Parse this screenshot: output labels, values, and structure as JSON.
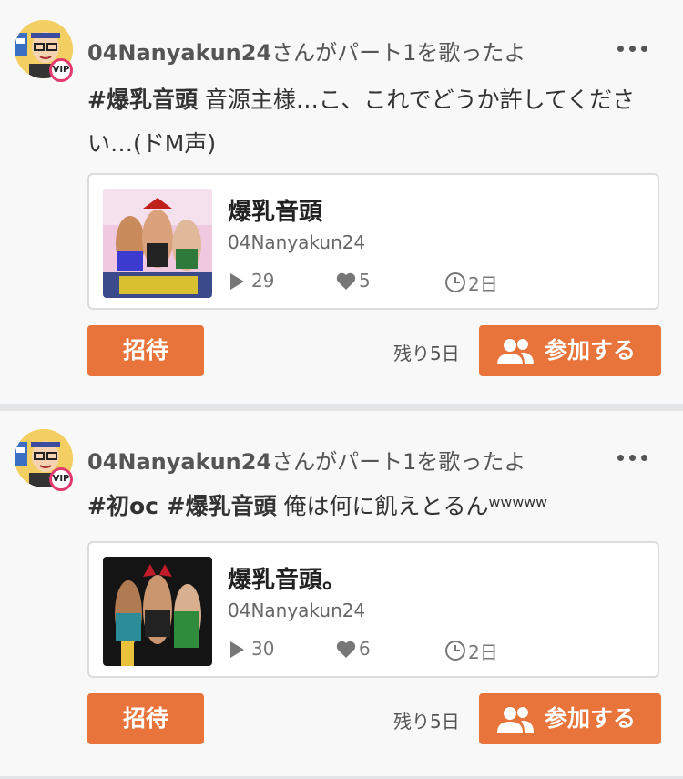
{
  "posts": [
    {
      "username": "04Nanyakun24",
      "action": "さんがパート1を歌ったよ",
      "badge": "VIP",
      "tags": [
        "#爆乳音頭"
      ],
      "message": " 音源主様…こ、これでどうか許してください…(ドM声)",
      "song": {
        "title": "爆乳音頭",
        "user": "04Nanyakun24",
        "plays": "29",
        "likes": "5",
        "age": "2日"
      },
      "invite_label": "招待",
      "remaining": "残り5日",
      "join_label": "参加する"
    },
    {
      "username": "04Nanyakun24",
      "action": "さんがパート1を歌ったよ",
      "badge": "VIP",
      "tags": [
        "#初oc",
        " #爆乳音頭"
      ],
      "message": " 俺は何に飢えとるんʷʷʷʷʷ",
      "song": {
        "title": "爆乳音頭。",
        "user": "04Nanyakun24",
        "plays": "30",
        "likes": "6",
        "age": "2日"
      },
      "invite_label": "招待",
      "remaining": "残り5日",
      "join_label": "参加する"
    }
  ],
  "colors": {
    "accent": "#e8743b",
    "vip_ring": "#e33b6d",
    "separator": "#e2e4e6"
  },
  "icons": [
    "more-icon",
    "play-icon",
    "heart-icon",
    "clock-icon",
    "people-icon"
  ]
}
